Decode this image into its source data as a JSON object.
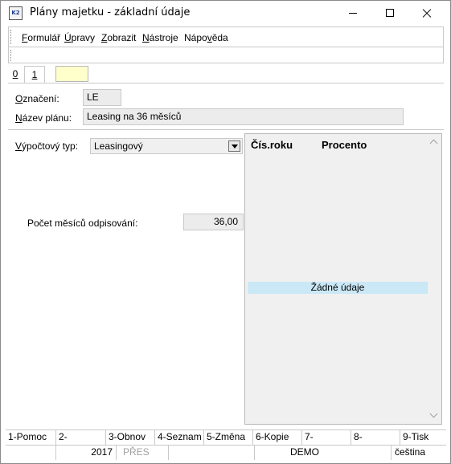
{
  "window": {
    "title": "Plány majetku - základní údaje",
    "icon": "K2"
  },
  "menu": [
    {
      "label": "Formulář",
      "underline": "F",
      "rest": "ormulář"
    },
    {
      "label": "Úpravy",
      "underline": "Ú",
      "rest": "pravy"
    },
    {
      "label": "Zobrazit",
      "underline": "Z",
      "rest": "obrazit"
    },
    {
      "label": "Nástroje",
      "underline": "N",
      "rest": "ástroje"
    },
    {
      "label": "Nápověda",
      "pre": "Nápo",
      "underline": "v",
      "rest": "ěda"
    }
  ],
  "tabs": {
    "tab0": "0",
    "tab1": "1"
  },
  "form": {
    "oznaceni_label": "Označení:",
    "oznaceni_value": "LE",
    "nazev_label": "Název plánu:",
    "nazev_value": "Leasing na 36 měsíců",
    "typ_label": "Výpočtový typ:",
    "typ_value": "Leasingový",
    "pocet_label": "Počet měsíců odpisování:",
    "pocet_value": "36,00"
  },
  "grid": {
    "columns": [
      "Čís.roku",
      "Procento"
    ],
    "empty_text": "Žádné údaje"
  },
  "function_keys": [
    "1-Pomoc",
    "2-",
    "3-Obnov",
    "4-Seznam",
    "5-Změna",
    "6-Kopie",
    "7-",
    "8-",
    "9-Tisk"
  ],
  "status": {
    "year": "2017",
    "mode": "PŘES",
    "db": "DEMO",
    "lang": "čeština"
  }
}
